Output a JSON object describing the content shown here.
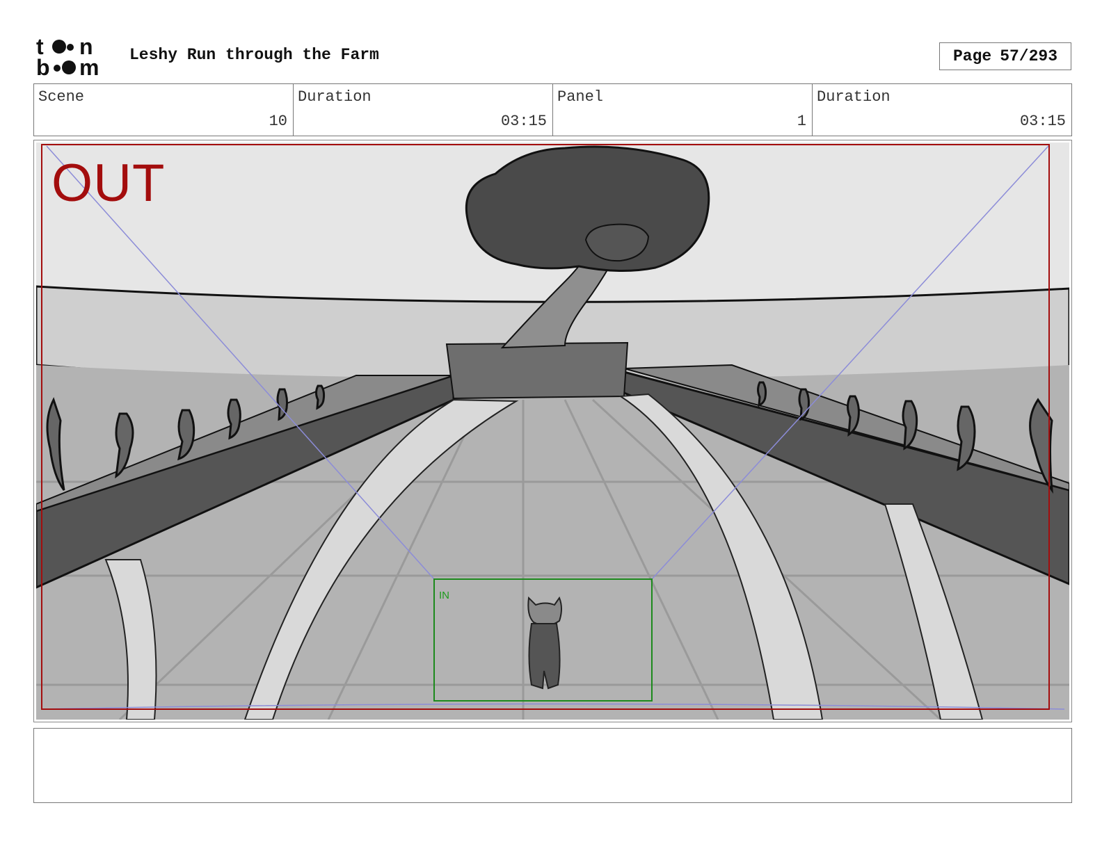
{
  "header": {
    "logo_text": "toon boom",
    "title": "Leshy Run through the Farm",
    "page_label": "Page",
    "page_value": "57/293"
  },
  "info": {
    "scene_label": "Scene",
    "scene_value": "10",
    "scene_duration_label": "Duration",
    "scene_duration_value": "03:15",
    "panel_label": "Panel",
    "panel_value": "1",
    "panel_duration_label": "Duration",
    "panel_duration_value": "03:15"
  },
  "panel": {
    "out_label": "OUT",
    "in_label": "IN",
    "colors": {
      "out_frame": "#a30d0d",
      "in_frame": "#1c8a1c",
      "guides": "#8c8cd8"
    }
  },
  "notes": {
    "text": ""
  }
}
